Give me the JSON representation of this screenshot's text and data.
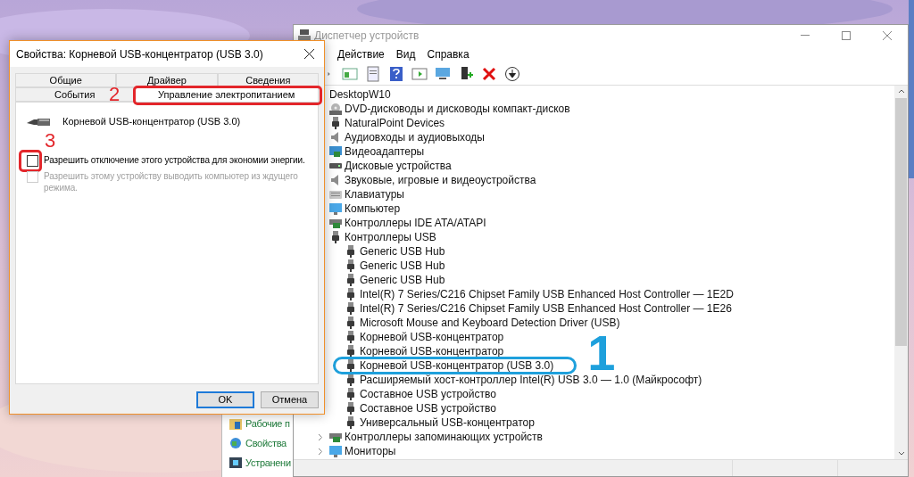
{
  "background_window": {
    "items": [
      {
        "label": "Рабочие п",
        "kind": "folder"
      },
      {
        "label": "Свойства",
        "kind": "globe"
      },
      {
        "label": "Устранени",
        "kind": "screen"
      }
    ]
  },
  "device_manager": {
    "title": "Диспетчер устройств",
    "menu": [
      "Действие",
      "Вид",
      "Справка"
    ],
    "tree": {
      "label": "DesktopW10",
      "children": [
        {
          "label": "DVD-дисководы и дисководы компакт-дисков",
          "kind": "dvd"
        },
        {
          "label": "NaturalPoint Devices",
          "kind": "usb"
        },
        {
          "label": "Аудиовходы и аудиовыходы",
          "kind": "audio"
        },
        {
          "label": "Видеоадаптеры",
          "kind": "video"
        },
        {
          "label": "Дисковые устройства",
          "kind": "disk"
        },
        {
          "label": "Звуковые, игровые и видеоустройства",
          "kind": "audio"
        },
        {
          "label": "Клавиатуры",
          "kind": "keyboard"
        },
        {
          "label": "Компьютер",
          "kind": "monitor"
        },
        {
          "label": "Контроллеры IDE ATA/ATAPI",
          "kind": "card"
        },
        {
          "label": "Контроллеры USB",
          "kind": "usb",
          "children": [
            {
              "label": "Generic USB Hub",
              "kind": "usb"
            },
            {
              "label": "Generic USB Hub",
              "kind": "usb"
            },
            {
              "label": "Generic USB Hub",
              "kind": "usb"
            },
            {
              "label": "Intel(R) 7 Series/C216 Chipset Family USB Enhanced Host Controller — 1E2D",
              "kind": "usb"
            },
            {
              "label": "Intel(R) 7 Series/C216 Chipset Family USB Enhanced Host Controller — 1E26",
              "kind": "usb"
            },
            {
              "label": "Microsoft Mouse and Keyboard Detection Driver (USB)",
              "kind": "usb"
            },
            {
              "label": "Корневой USB-концентратор",
              "kind": "usb"
            },
            {
              "label": "Корневой USB-концентратор",
              "kind": "usb"
            },
            {
              "label": "Корневой USB-концентратор (USB 3.0)",
              "kind": "usb",
              "annotation": {
                "text": "1",
                "color": "#1ea0dc"
              }
            },
            {
              "label": "Расширяемый хост-контроллер Intel(R) USB 3.0 — 1.0 (Майкрософт)",
              "kind": "usb"
            },
            {
              "label": "Составное USB устройство",
              "kind": "usb"
            },
            {
              "label": "Составное USB устройство",
              "kind": "usb"
            },
            {
              "label": "Универсальный USB-концентратор",
              "kind": "usb"
            }
          ]
        },
        {
          "label": "Контроллеры запоминающих устройств",
          "kind": "card",
          "expanded": false
        },
        {
          "label": "Мониторы",
          "kind": "monitor",
          "expanded": false
        }
      ]
    }
  },
  "dialog": {
    "title": "Свойства: Корневой USB-концентратор (USB 3.0)",
    "tab_rows": [
      [
        {
          "label": "Общие",
          "selected": false
        },
        {
          "label": "Драйвер",
          "selected": false
        },
        {
          "label": "Сведения",
          "selected": false
        }
      ],
      [
        {
          "label": "События",
          "selected": false
        },
        {
          "label": "Управление электропитанием",
          "selected": true,
          "annotation": {
            "text": "2",
            "color": "#e3262b"
          }
        }
      ]
    ],
    "device_name": "Корневой USB-концентратор (USB 3.0)",
    "options": [
      {
        "label": "Разрешить отключение этого устройства для экономии энергии.",
        "checked": false,
        "disabled": false,
        "annotation": {
          "text": "3",
          "color": "#e3262b"
        }
      },
      {
        "label": "Разрешить этому устройству выводить компьютер из ждущего режима.",
        "checked": false,
        "disabled": true
      }
    ],
    "buttons": [
      {
        "label": "OK",
        "default": true
      },
      {
        "label": "Отмена",
        "default": false
      }
    ]
  }
}
